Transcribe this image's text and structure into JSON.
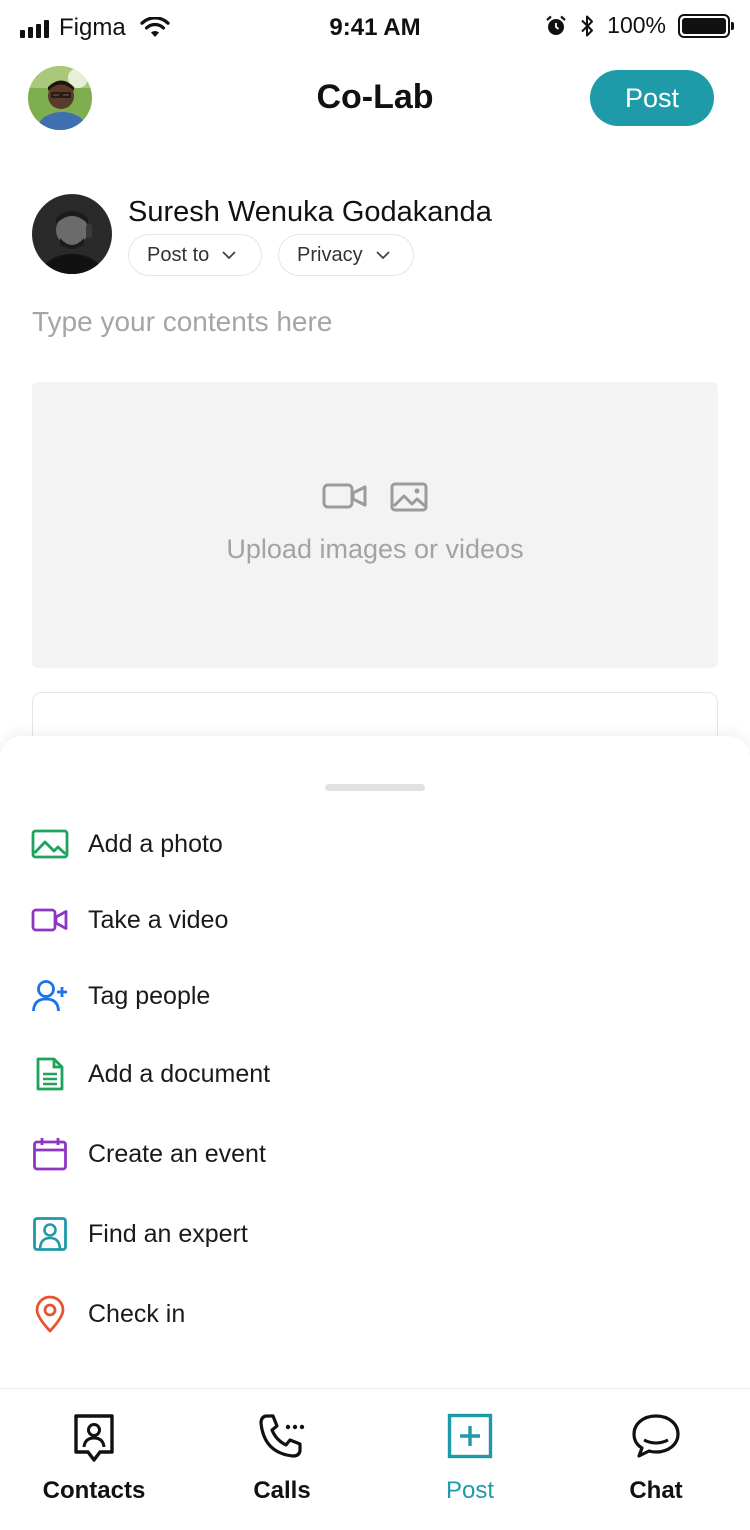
{
  "status_bar": {
    "carrier": "Figma",
    "time": "9:41 AM",
    "battery": "100%"
  },
  "header": {
    "title": "Co-Lab",
    "post_label": "Post"
  },
  "composer": {
    "author_name": "Suresh Wenuka Godakanda",
    "post_to_label": "Post to",
    "privacy_label": "Privacy",
    "content_placeholder": "Type your contents here",
    "upload_label": "Upload images or videos"
  },
  "sheet": {
    "actions": [
      {
        "label": "Add a photo",
        "icon": "image-icon",
        "color": "#1fa35c"
      },
      {
        "label": "Take a video",
        "icon": "video-icon",
        "color": "#8e35c4"
      },
      {
        "label": "Tag people",
        "icon": "user-plus-icon",
        "color": "#1a73e8"
      },
      {
        "label": "Add a document",
        "icon": "document-icon",
        "color": "#1fa35c"
      },
      {
        "label": "Create an event",
        "icon": "calendar-icon",
        "color": "#8e35c4"
      },
      {
        "label": "Find an expert",
        "icon": "expert-icon",
        "color": "#1e9aa8"
      },
      {
        "label": "Check in",
        "icon": "location-pin-icon",
        "color": "#e8532f"
      }
    ]
  },
  "tabbar": {
    "tabs": [
      {
        "label": "Contacts",
        "icon": "contacts-icon"
      },
      {
        "label": "Calls",
        "icon": "phone-icon"
      },
      {
        "label": "Post",
        "icon": "add-post-icon",
        "active": true
      },
      {
        "label": "Chat",
        "icon": "chat-icon"
      }
    ]
  },
  "colors": {
    "accent": "#1e9aa8"
  }
}
